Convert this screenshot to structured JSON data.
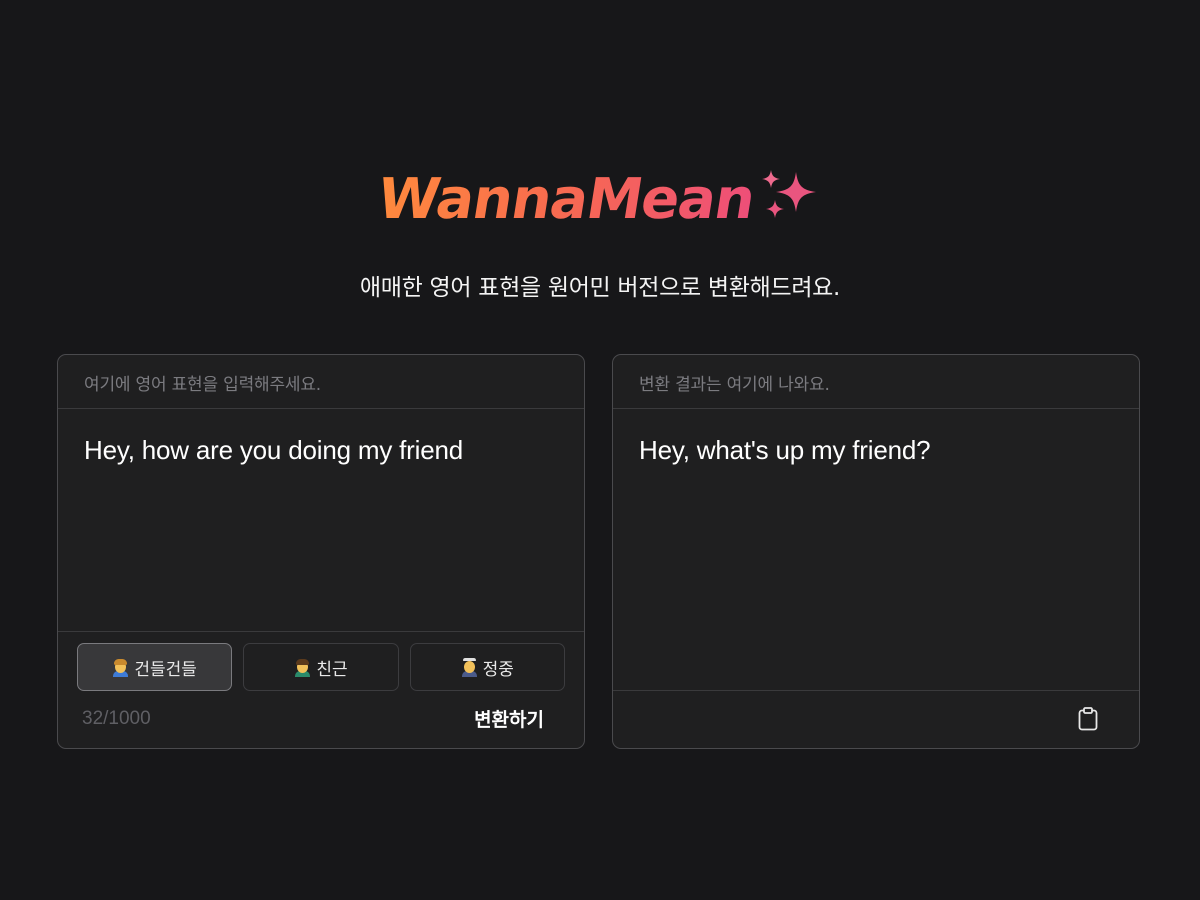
{
  "header": {
    "logo": "WannaMean",
    "subtitle": "애매한 영어 표현을 원어민 버전으로 변환해드려요."
  },
  "input_panel": {
    "placeholder": "여기에 영어 표현을 입력해주세요.",
    "value": "Hey, how are you doing my friend",
    "tones": [
      {
        "label": "건들건들",
        "icon": "casual-person-emoji",
        "selected": true
      },
      {
        "label": "친근",
        "icon": "friendly-person-emoji",
        "selected": false
      },
      {
        "label": "정중",
        "icon": "polite-person-emoji",
        "selected": false
      }
    ],
    "char_count": "32/1000",
    "convert_label": "변환하기"
  },
  "output_panel": {
    "placeholder": "변환 결과는 여기에 나와요.",
    "value": "Hey, what's up my friend?",
    "copy_icon": "clipboard-icon"
  },
  "colors": {
    "background": "#171719",
    "panel": "#1f1f20",
    "logo_gradient_start": "#ff8a3d",
    "logo_gradient_end": "#ee4e79",
    "sparkle": "#e9557f"
  }
}
